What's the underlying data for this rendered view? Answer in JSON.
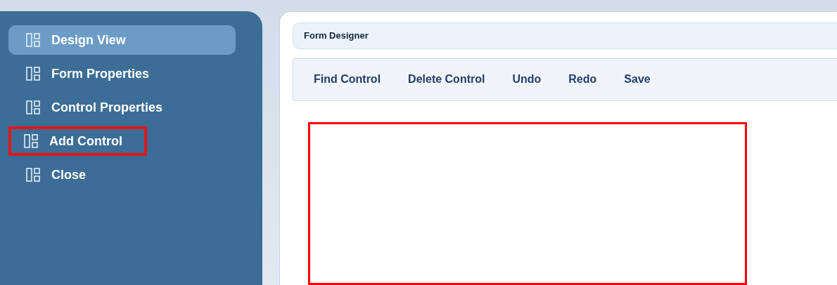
{
  "sidebar": {
    "items": [
      {
        "label": "Design View",
        "selected": true,
        "highlighted": false
      },
      {
        "label": "Form Properties",
        "selected": false,
        "highlighted": false
      },
      {
        "label": "Control Properties",
        "selected": false,
        "highlighted": false
      },
      {
        "label": "Add Control",
        "selected": false,
        "highlighted": true
      },
      {
        "label": "Close",
        "selected": false,
        "highlighted": false
      }
    ]
  },
  "main": {
    "title": "Form Designer",
    "toolbar": [
      "Find Control",
      "Delete Control",
      "Undo",
      "Redo",
      "Save"
    ],
    "canvas": {
      "highlighted": true
    }
  }
}
